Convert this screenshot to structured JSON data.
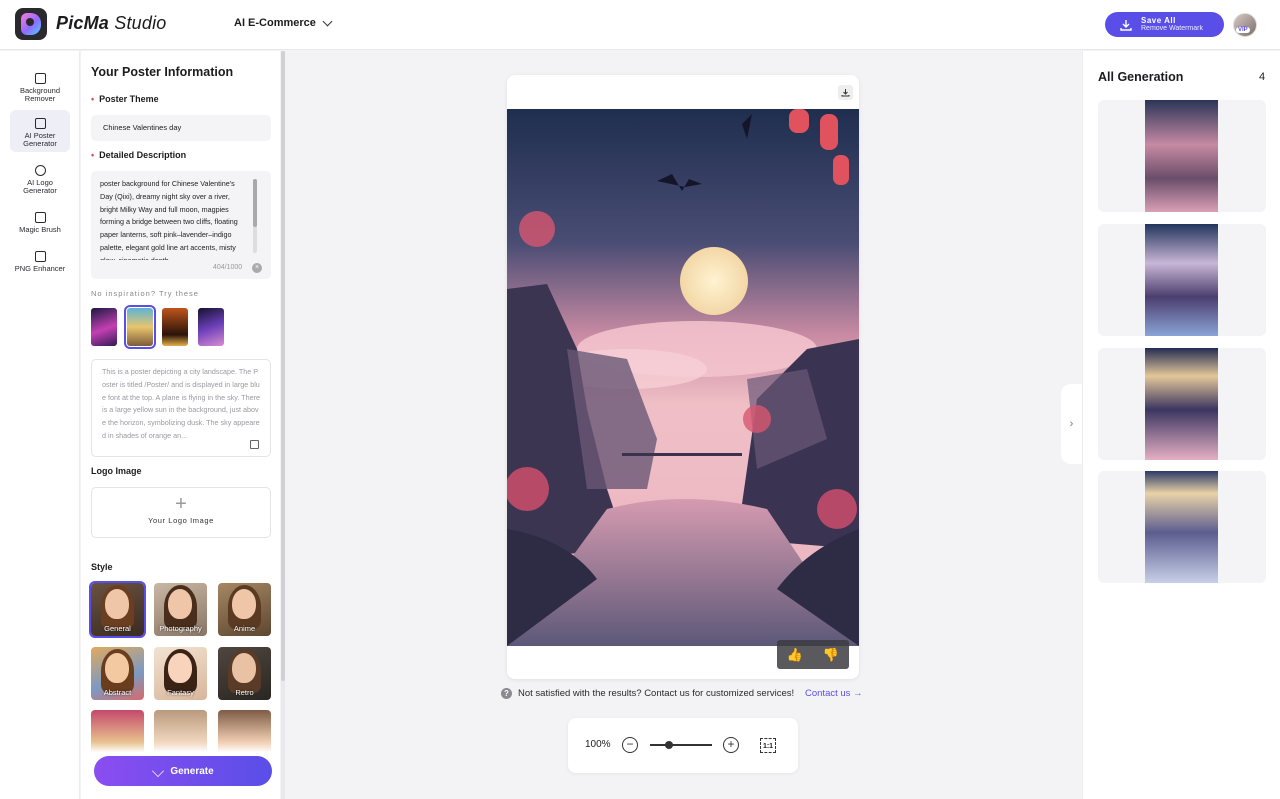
{
  "header": {
    "brand_bold": "PicMa",
    "brand_light": "Studio",
    "nav_dropdown": "AI E-Commerce",
    "save_title": "Save All",
    "save_sub": "Remove Watermark",
    "vip": "VIP"
  },
  "toolbar": [
    {
      "label": "Background Remover",
      "icon": "background-remover-icon"
    },
    {
      "label": "AI Poster Generator",
      "icon": "poster-icon"
    },
    {
      "label": "AI Logo Generator",
      "icon": "logo-icon"
    },
    {
      "label": "Magic Brush",
      "icon": "brush-icon"
    },
    {
      "label": "PNG Enhancer",
      "icon": "png-icon"
    }
  ],
  "panel": {
    "title": "Your Poster Information",
    "theme_label": "Poster Theme",
    "theme_value": "Chinese Valentines day",
    "desc_label": "Detailed Description",
    "desc_value": "poster background for Chinese Valentine's Day (Qixi), dreamy night sky over a river, bright Milky Way and full moon, magpies forming a bridge between two cliffs, floating paper lanterns, soft pink–lavender–indigo palette, elegant gold line art accents, misty glow, cinematic depth",
    "desc_count": "404/1000",
    "inspiration_label": "No inspiration? Try these",
    "prompt_value": "This is a poster depicting a city landscape. The Poster is titled /Poster/ and is displayed in large blue font at the top. A plane is flying in the sky. There is a large yellow sun in the background, just above the horizon, symbolizing dusk. The sky appeared in shades of orange an...",
    "logo_label": "Logo Image",
    "logo_upload": "Your Logo Image",
    "style_label": "Style",
    "styles": [
      "General",
      "Photography",
      "Anime",
      "Abstract",
      "Fantasy",
      "Retro"
    ],
    "generate": "Generate"
  },
  "canvas": {
    "notice": "Not satisfied with the results? Contact us for customized services!",
    "contact": "Contact us",
    "zoom": "100%",
    "zoom_level": 0.3
  },
  "right": {
    "title": "All Generation",
    "count": "4"
  },
  "colors": {
    "accent": "#5a4ee8",
    "generate_start": "#8b4df0"
  }
}
